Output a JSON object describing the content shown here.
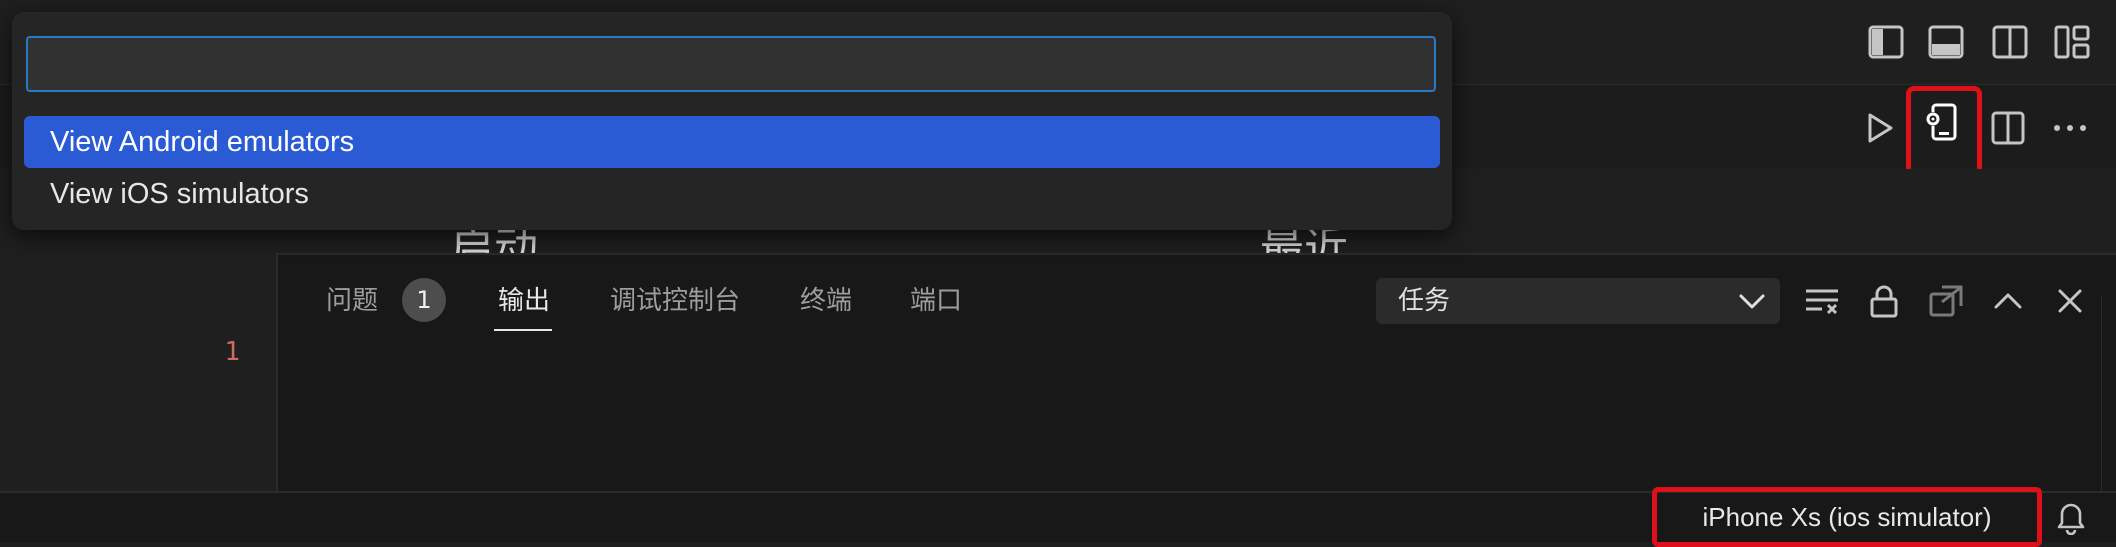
{
  "quick_pick": {
    "input_value": "",
    "items": [
      {
        "label": "View Android emulators",
        "selected": true
      },
      {
        "label": "View iOS simulators",
        "selected": false
      }
    ]
  },
  "editor": {
    "line_numbers": [
      "1"
    ],
    "headings": [
      "启动",
      "最近"
    ]
  },
  "panel": {
    "tabs": [
      {
        "label": "问题",
        "active": false
      },
      {
        "label": "输出",
        "active": true
      },
      {
        "label": "调试控制台",
        "active": false
      },
      {
        "label": "终端",
        "active": false
      },
      {
        "label": "端口",
        "active": false
      }
    ],
    "problems_count": "1",
    "output_channel": "任务"
  },
  "status_bar": {
    "device": "iPhone Xs (ios simulator)"
  },
  "icons": {
    "titlebar": [
      "toggle-primary-sidebar-icon",
      "toggle-panel-icon",
      "toggle-secondary-sidebar-icon",
      "customize-layout-icon"
    ],
    "editor_actions": [
      "run-icon",
      "device-settings-icon",
      "split-editor-icon",
      "more-actions-icon"
    ],
    "panel_actions": [
      "clear-output-icon",
      "lock-scroll-icon",
      "open-in-editor-icon",
      "maximize-panel-icon",
      "close-panel-icon"
    ],
    "status": [
      "notification-bell-icon"
    ]
  },
  "colors": {
    "accent": "#2a5ad4",
    "highlight": "#e0101a",
    "focus_border": "#2a79c7"
  }
}
